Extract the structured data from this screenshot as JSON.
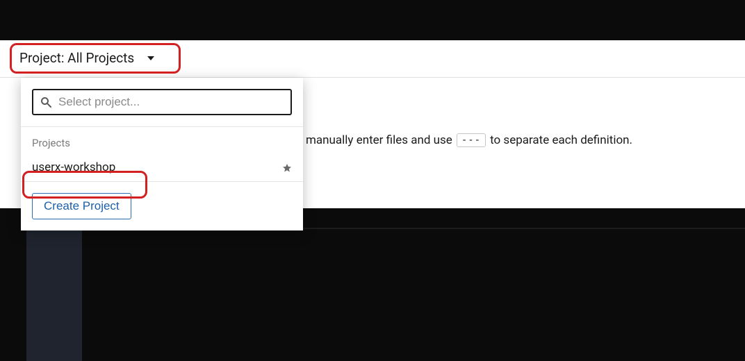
{
  "toolbar": {
    "project_label": "Project: All Projects"
  },
  "dropdown": {
    "search_placeholder": "Select project...",
    "section_label": "Projects",
    "items": [
      {
        "name": "userx-workshop"
      }
    ],
    "create_label": "Create Project"
  },
  "content": {
    "text_before": "manually enter files and use",
    "code_token": "---",
    "text_after": "to separate each definition."
  }
}
